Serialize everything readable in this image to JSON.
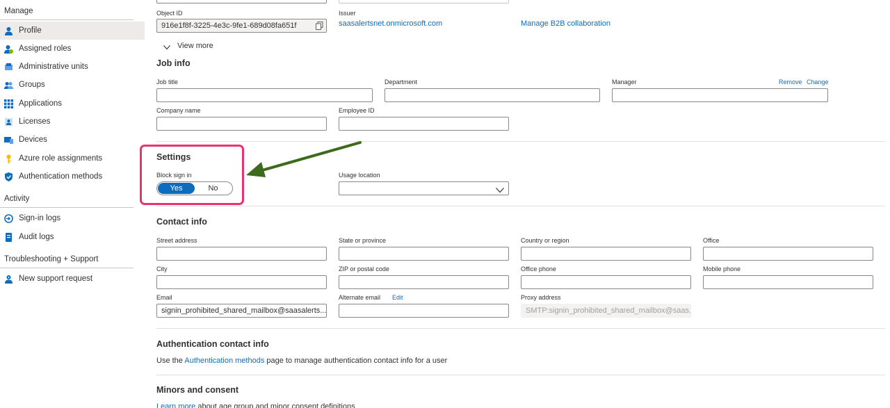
{
  "sidebar": {
    "manage_title": "Manage",
    "manage_items": [
      {
        "label": "Profile",
        "icon": "person-icon",
        "active": true
      },
      {
        "label": "Assigned roles",
        "icon": "roles-icon"
      },
      {
        "label": "Administrative units",
        "icon": "admin-units-icon"
      },
      {
        "label": "Groups",
        "icon": "groups-icon"
      },
      {
        "label": "Applications",
        "icon": "apps-grid-icon"
      },
      {
        "label": "Licenses",
        "icon": "license-icon"
      },
      {
        "label": "Devices",
        "icon": "devices-icon"
      },
      {
        "label": "Azure role assignments",
        "icon": "key-icon"
      },
      {
        "label": "Authentication methods",
        "icon": "shield-icon"
      }
    ],
    "activity_title": "Activity",
    "activity_items": [
      {
        "label": "Sign-in logs",
        "icon": "signin-logs-icon"
      },
      {
        "label": "Audit logs",
        "icon": "audit-logs-icon"
      }
    ],
    "support_title": "Troubleshooting + Support",
    "support_items": [
      {
        "label": "New support request",
        "icon": "support-person-icon"
      }
    ]
  },
  "identity": {
    "object_id_label": "Object ID",
    "object_id_value": "916e1f8f-3225-4e3c-9fe1-689d08fa651f",
    "issuer_label": "Issuer",
    "issuer_value": "saasalertsnet.onmicrosoft.com",
    "b2b_link": "Manage B2B collaboration",
    "view_more": "View more"
  },
  "job_info": {
    "title": "Job info",
    "job_title_label": "Job title",
    "department_label": "Department",
    "manager_label": "Manager",
    "manager_remove": "Remove",
    "manager_change": "Change",
    "company_label": "Company name",
    "employee_id_label": "Employee ID"
  },
  "settings": {
    "title": "Settings",
    "block_label": "Block sign in",
    "yes": "Yes",
    "no": "No",
    "selected": "Yes",
    "usage_label": "Usage location"
  },
  "contact": {
    "title": "Contact info",
    "street_label": "Street address",
    "state_label": "State or province",
    "country_label": "Country or region",
    "office_label": "Office",
    "city_label": "City",
    "zip_label": "ZIP or postal code",
    "office_phone_label": "Office phone",
    "mobile_label": "Mobile phone",
    "email_label": "Email",
    "email_value": "signin_prohibited_shared_mailbox@saasalerts....",
    "alt_email_label": "Alternate email",
    "alt_email_edit": "Edit",
    "proxy_label": "Proxy address",
    "proxy_value": "SMTP:signin_prohibited_shared_mailbox@saas..."
  },
  "auth_contact": {
    "title": "Authentication contact info",
    "text_pre": "Use the",
    "link": "Authentication methods",
    "text_post": "page to manage authentication contact info for a user"
  },
  "minors": {
    "title": "Minors and consent",
    "link": "Learn more",
    "text_post": "about age group and minor consent definitions"
  },
  "colors": {
    "accent": "#0f6cbd",
    "highlight": "#e8336e",
    "arrow": "#3d6b1c"
  }
}
